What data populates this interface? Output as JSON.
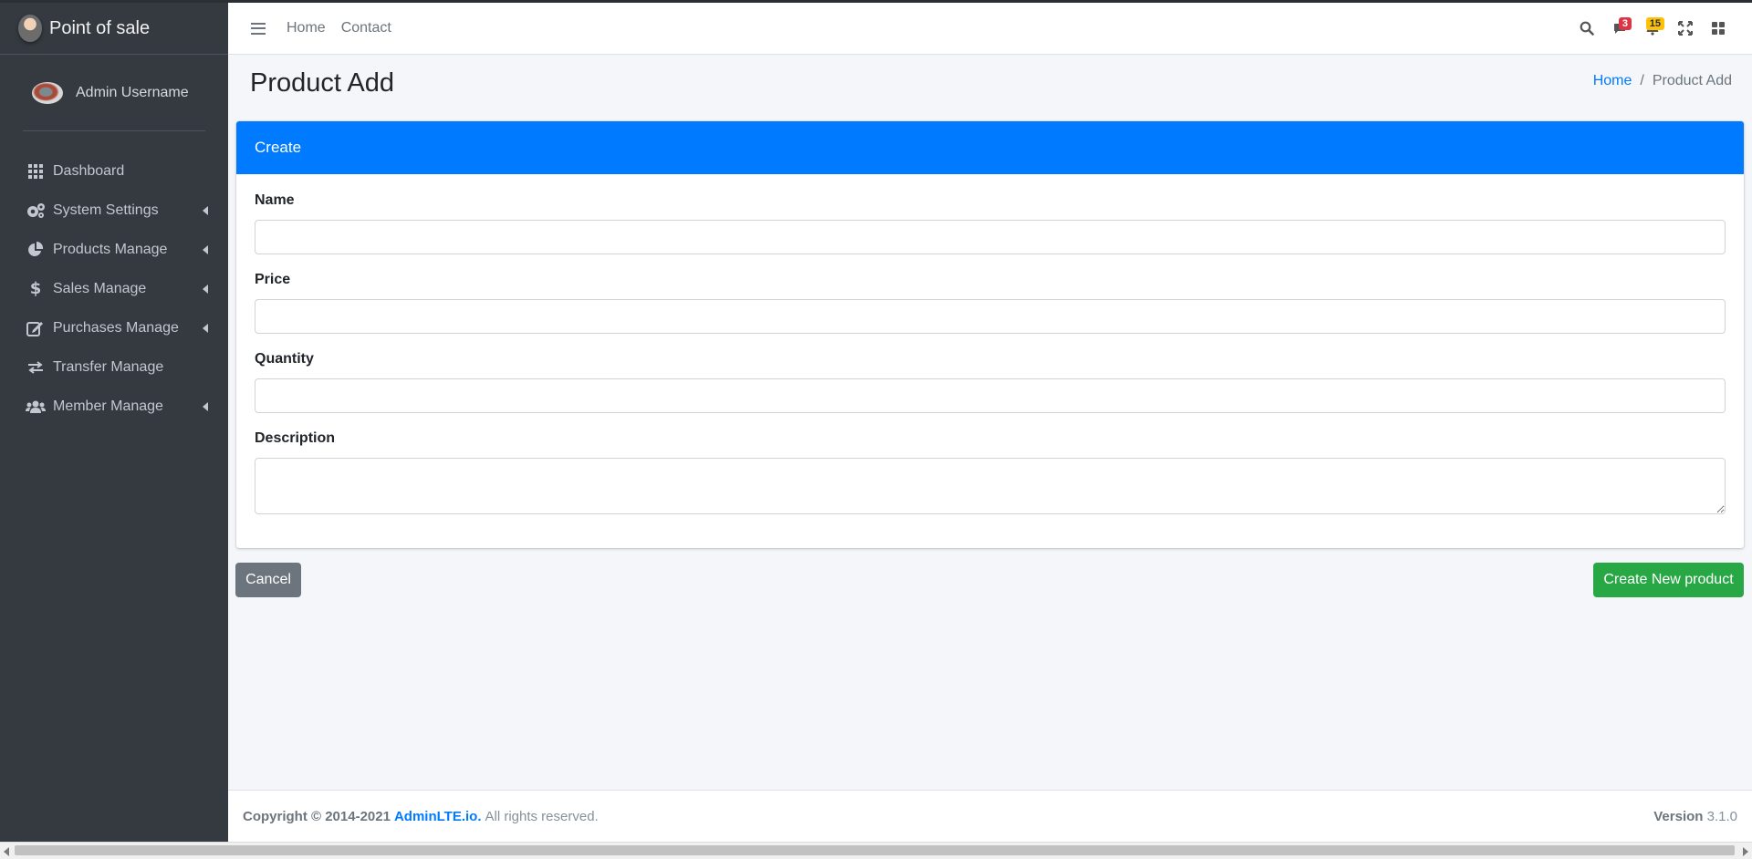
{
  "brand": {
    "title": "Point of sale"
  },
  "user": {
    "name": "Admin Username"
  },
  "sidebar": {
    "items": [
      {
        "label": "Dashboard",
        "icon": "th-grid-icon",
        "has_children": false
      },
      {
        "label": "System Settings",
        "icon": "cogs-icon",
        "has_children": true
      },
      {
        "label": "Products Manage",
        "icon": "chart-pie-icon",
        "has_children": true
      },
      {
        "label": "Sales Manage",
        "icon": "dollar-icon",
        "has_children": true
      },
      {
        "label": "Purchases Manage",
        "icon": "edit-icon",
        "has_children": true
      },
      {
        "label": "Transfer Manage",
        "icon": "exchange-icon",
        "has_children": false
      },
      {
        "label": "Member Manage",
        "icon": "users-icon",
        "has_children": true
      }
    ]
  },
  "navbar": {
    "links": [
      "Home",
      "Contact"
    ],
    "messages_badge": "3",
    "notifications_badge": "15"
  },
  "page": {
    "title": "Product Add",
    "breadcrumb": {
      "home": "Home",
      "current": "Product Add"
    }
  },
  "form": {
    "header": "Create",
    "fields": {
      "name": {
        "label": "Name",
        "value": ""
      },
      "price": {
        "label": "Price",
        "value": ""
      },
      "quantity": {
        "label": "Quantity",
        "value": ""
      },
      "description": {
        "label": "Description",
        "value": ""
      }
    },
    "cancel_label": "Cancel",
    "submit_label": "Create New product"
  },
  "footer": {
    "copyright": "Copyright © 2014-2021",
    "brand_link": "AdminLTE.io.",
    "rights": "All rights reserved.",
    "version_label": "Version",
    "version": "3.1.0"
  },
  "colors": {
    "sidebar_bg": "#343a40",
    "primary": "#007bff",
    "success": "#28a745",
    "secondary": "#6c757d",
    "danger": "#dc3545",
    "warning": "#ffc107"
  }
}
